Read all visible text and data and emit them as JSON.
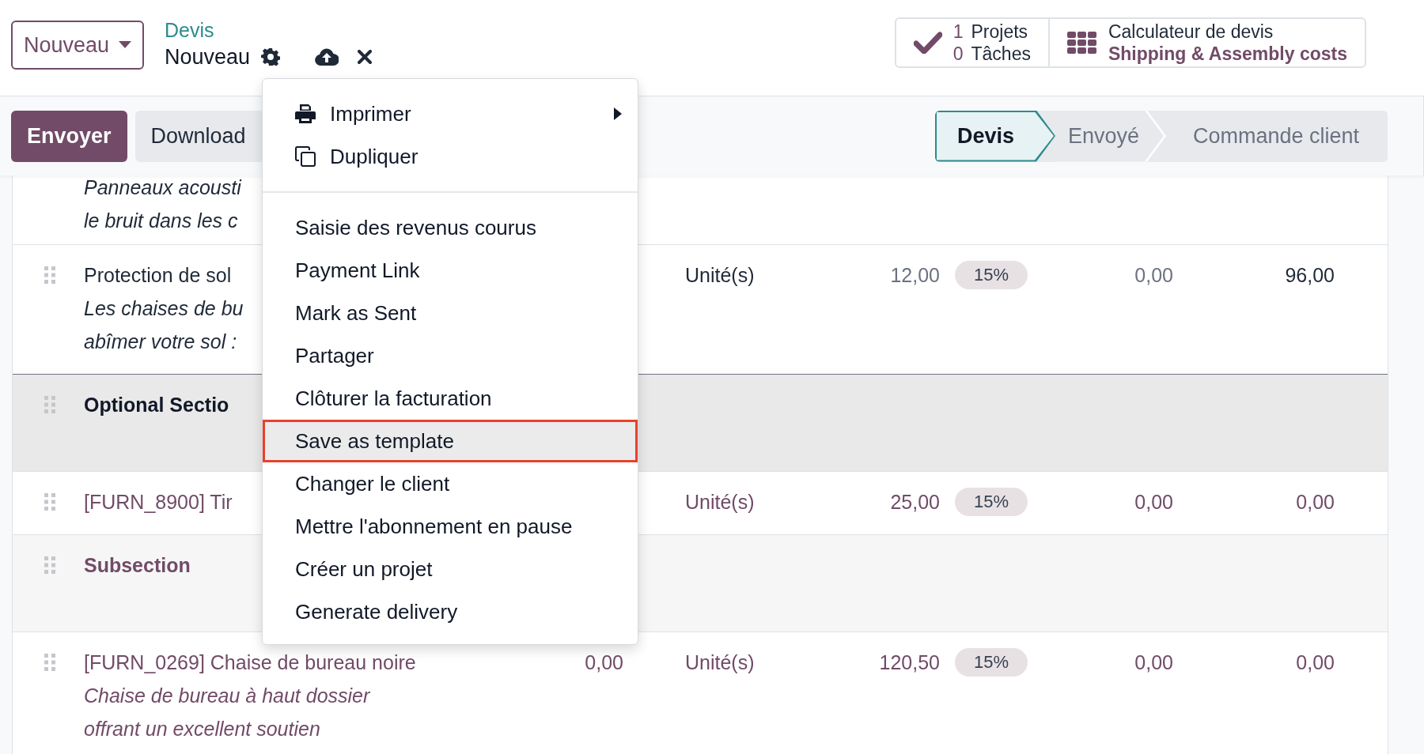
{
  "control_panel": {
    "new_button": "Nouveau",
    "breadcrumb": "Devis",
    "record_name": "Nouveau"
  },
  "smart_buttons": [
    {
      "kind": "projects",
      "lines": [
        {
          "count": "1",
          "label": "Projets"
        },
        {
          "count": "0",
          "label": "Tâches"
        }
      ]
    },
    {
      "kind": "calculator",
      "title": "Calculateur de devis",
      "subtitle": "Shipping & Assembly costs"
    }
  ],
  "actions": [
    {
      "label": "Envoyer",
      "primary": true
    },
    {
      "label": "Download",
      "primary": false
    }
  ],
  "status_bar": [
    {
      "label": "Devis",
      "selected": true
    },
    {
      "label": "Envoyé",
      "selected": false
    },
    {
      "label": "Commande client",
      "selected": false
    }
  ],
  "rows": [
    {
      "kind": "product",
      "accent": false,
      "description": [
        "Panneaux acousti",
        "le bruit dans les c"
      ]
    },
    {
      "kind": "product",
      "accent": false,
      "name": "Protection de sol",
      "description": [
        "Les chaises de bu",
        "abîmer votre sol :"
      ],
      "unit": "Unité(s)",
      "price": "12,00",
      "tax": "15%",
      "discount": "0,00",
      "subtotal": "96,00"
    },
    {
      "kind": "section",
      "name": "Optional Sectio"
    },
    {
      "kind": "product",
      "accent": true,
      "name": "[FURN_8900] Tir",
      "unit": "Unité(s)",
      "price": "25,00",
      "tax": "15%",
      "discount": "0,00",
      "subtotal": "0,00"
    },
    {
      "kind": "subsection",
      "name": "Subsection"
    },
    {
      "kind": "product",
      "accent": true,
      "name": "[FURN_0269] Chaise de bureau noire",
      "description": [
        "Chaise de bureau à haut dossier",
        "offrant un excellent soutien"
      ],
      "qty": "0,00",
      "unit": "Unité(s)",
      "price": "120,50",
      "tax": "15%",
      "discount": "0,00",
      "subtotal": "0,00"
    }
  ],
  "action_menu": {
    "groups": [
      {
        "items": [
          {
            "label": "Imprimer",
            "submenu": true,
            "selected": false
          },
          {
            "label": "Dupliquer",
            "submenu": false,
            "selected": false
          }
        ]
      },
      {
        "items": [
          {
            "label": "Saisie des revenus courus",
            "selected": false
          },
          {
            "label": "Payment Link",
            "selected": false
          },
          {
            "label": "Mark as Sent",
            "selected": false
          },
          {
            "label": "Partager",
            "selected": false
          },
          {
            "label": "Clôturer la facturation",
            "selected": false
          },
          {
            "label": "Save as template",
            "selected": true
          },
          {
            "label": "Changer le client",
            "selected": false
          },
          {
            "label": "Mettre l'abonnement en pause",
            "selected": false
          },
          {
            "label": "Créer un projet",
            "selected": false
          },
          {
            "label": "Generate delivery",
            "selected": false
          }
        ]
      }
    ]
  }
}
